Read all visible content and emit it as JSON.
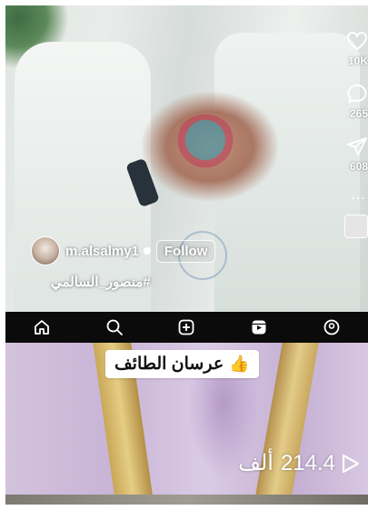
{
  "top_video": {
    "actions": {
      "likes_count": "10K",
      "comments_count": "265",
      "shares_count": "608",
      "more_label": "⋯"
    },
    "author": {
      "username": "m.alsalmy1",
      "follow_label": "Follow"
    },
    "hashtag": "#منصور_السالمي"
  },
  "nav": {
    "icons": [
      "home-icon",
      "search-icon",
      "create-icon",
      "reels-icon",
      "profile-icon"
    ]
  },
  "bottom_video": {
    "caption": "عرسان الطائف",
    "caption_emoji": "👍",
    "views_value": "214.4",
    "views_unit": "ألف"
  },
  "colors": {
    "nav_bg": "#0b0b0b",
    "text_on_video": "#ffffff",
    "caption_bg": "#ffffff"
  }
}
